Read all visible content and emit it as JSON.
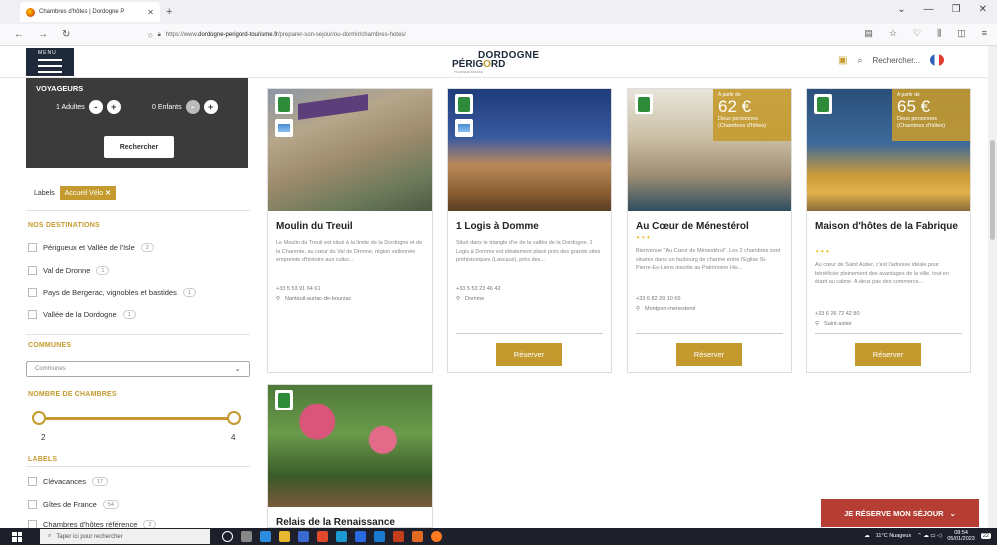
{
  "browser": {
    "tab_title": "Chambres d'hôtes | Dordogne P",
    "tab_close": "✕",
    "new_tab": "+",
    "url_prefix": "https://www.",
    "url_domain": "dordogne-perigord-tourisme.fr",
    "url_path": "/preparer-son-sejour/ou-dormir/chambres-hotes/",
    "window_controls": [
      "⌄",
      "—",
      "❐",
      "✕"
    ]
  },
  "header": {
    "menu_label": "MENU",
    "logo_line1": "DORDOGNE",
    "logo_line2_a": "PÉRIG",
    "logo_line2_b": "O",
    "logo_line2_c": "RD",
    "logo_tagline": "TOURISME FRANCE",
    "search_label": "Rechercher..."
  },
  "voyageurs": {
    "title": "VOYAGEURS",
    "adults_label": "1 Adultes",
    "children_label": "0 Enfants",
    "minus": "-",
    "plus": "+",
    "search_button": "Rechercher"
  },
  "filters": {
    "labels_title": "Labels",
    "active_tag": "Accueil Vélo",
    "tag_close": "✕",
    "destinations_title": "NOS DESTINATIONS",
    "destinations": [
      {
        "label": "Périgueux et Vallée de l'Isle",
        "count": "2"
      },
      {
        "label": "Val de Dronne",
        "count": "1"
      },
      {
        "label": "Pays de Bergerac, vignobles et bastides",
        "count": "1"
      },
      {
        "label": "Vallée de la Dordogne",
        "count": "1"
      }
    ],
    "communes_title": "COMMUNES",
    "communes_placeholder": "Communes",
    "chambres_title": "NOMBRE DE CHAMBRES",
    "chambres_min": "2",
    "chambres_max": "4",
    "labels_section_title": "LABELS",
    "labels": [
      {
        "label": "Clévacances",
        "count": "17"
      },
      {
        "label": "Gîtes de France",
        "count": "54"
      },
      {
        "label": "Chambres d'hôtes référence",
        "count": "2"
      }
    ]
  },
  "cards": [
    {
      "title": "Moulin du Treuil",
      "description": "Le Moulin du Treuil est situé à la limite de la Dordogne et de la Charente, au cœur du Val de Dronne, région vallonnée empreinte d'histoire aux cultur...",
      "phone": "+33 5 53 91 64 61",
      "location": "Nanteuil-auriac-de-bourzac"
    },
    {
      "title": "1 Logis à Domme",
      "description": "Situé dans le triangle d'or de la vallée de la Dordogne, 1 Logis à Domme est idéalement placé près des grands sites préhistoriques (Lascaux), près des...",
      "phone": "+33 5 53 23 46 42",
      "location": "Domme",
      "button": "Réserver"
    },
    {
      "title": "Au Cœur de Ménestérol",
      "stars": "✦✦✦",
      "description": "Bienvenue \"Au Cœur de Ménestérol\". Les 2 chambres sont situées dans un faubourg de charme entre l'Eglise St-Pierre-Es-Liens inscrite au Patrimoine His...",
      "phone": "+33 6 82 29 10 65",
      "location": "Montpon-menesterol",
      "button": "Réserver",
      "price_prefix": "A partir de",
      "price": "62 €",
      "price_note": "Deux personnes (Chambres d'hôtes)"
    },
    {
      "title": "Maison d'hôtes de la Fabrique",
      "stars": "✦✦✦",
      "description": "Au cœur de Saint Astier, c'est l'adresse idéale pour bénéficier pleinement des avantages de la ville, tout en étant au calme. A deux pas des commerce...",
      "phone": "+33 6 26 72 42 80",
      "location": "Saint-astier",
      "button": "Réserver",
      "price_prefix": "A partir de",
      "price": "65 €",
      "price_note": "Deux personnes (Chambres d'hôtes)"
    },
    {
      "title": "Relais de la Renaissance"
    }
  ],
  "reserve_bar": {
    "label": "JE RÉSERVE MON SÉJOUR",
    "chevron": "⌄"
  },
  "taskbar": {
    "search_placeholder": "Taper ici pour rechercher",
    "weather": "11°C Nuageux",
    "time": "08:54",
    "date": "05/01/2023",
    "notif_count": "22"
  },
  "colors": {
    "accent": "#c49a2e",
    "dark": "#3b3b3b",
    "reserve": "#b63d33",
    "navy": "#1e2a3a"
  }
}
